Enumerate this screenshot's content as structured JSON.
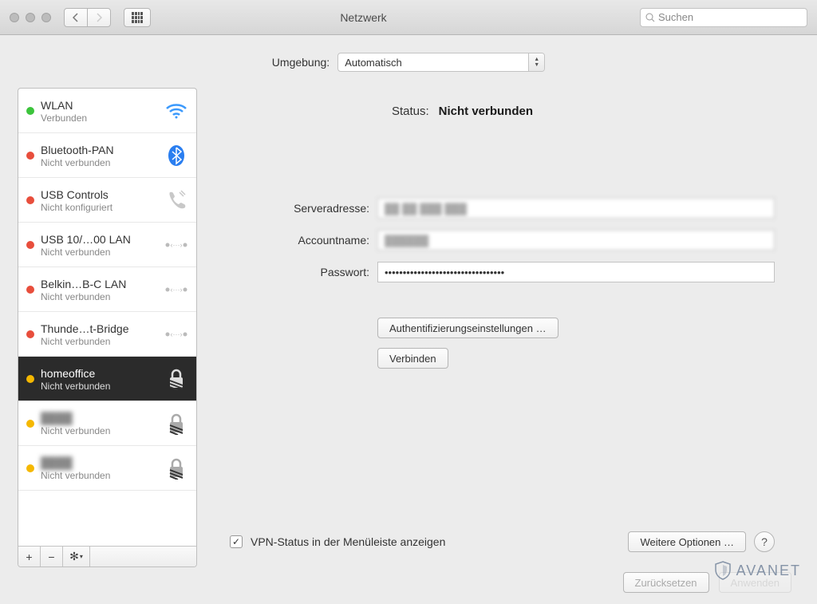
{
  "window": {
    "title": "Netzwerk",
    "search_placeholder": "Suchen"
  },
  "location": {
    "label": "Umgebung:",
    "selected": "Automatisch"
  },
  "sidebar": {
    "items": [
      {
        "name": "WLAN",
        "status": "Verbunden",
        "dot": "green",
        "icon": "wifi"
      },
      {
        "name": "Bluetooth-PAN",
        "status": "Nicht verbunden",
        "dot": "red",
        "icon": "bluetooth"
      },
      {
        "name": "USB Controls",
        "status": "Nicht konfiguriert",
        "dot": "red",
        "icon": "phone"
      },
      {
        "name": "USB 10/…00 LAN",
        "status": "Nicht verbunden",
        "dot": "red",
        "icon": "ethernet"
      },
      {
        "name": "Belkin…B-C LAN",
        "status": "Nicht verbunden",
        "dot": "red",
        "icon": "ethernet"
      },
      {
        "name": "Thunde…t-Bridge",
        "status": "Nicht verbunden",
        "dot": "red",
        "icon": "ethernet"
      },
      {
        "name": "homeoffice",
        "status": "Nicht verbunden",
        "dot": "yellow",
        "icon": "lock",
        "selected": true
      },
      {
        "name": "████",
        "status": "Nicht verbunden",
        "dot": "yellow",
        "icon": "lock",
        "blurred": true
      },
      {
        "name": "████",
        "status": "Nicht verbunden",
        "dot": "yellow",
        "icon": "lock",
        "blurred": true
      }
    ]
  },
  "detail": {
    "status_label": "Status:",
    "status_value": "Nicht verbunden",
    "fields": {
      "server_label": "Serveradresse:",
      "server_value": "██ ██ ███ ███",
      "account_label": "Accountname:",
      "account_value": "██████",
      "password_label": "Passwort:",
      "password_value": "•••••••••••••••••••••••••••••••••"
    },
    "auth_button": "Authentifizierungseinstellungen …",
    "connect_button": "Verbinden",
    "menubar_checkbox_label": "VPN-Status in der Menüleiste anzeigen",
    "menubar_checked": true,
    "advanced_button": "Weitere Optionen …",
    "help_button": "?"
  },
  "footer": {
    "revert": "Zurücksetzen",
    "apply": "Anwenden"
  },
  "watermark": "AVANET"
}
